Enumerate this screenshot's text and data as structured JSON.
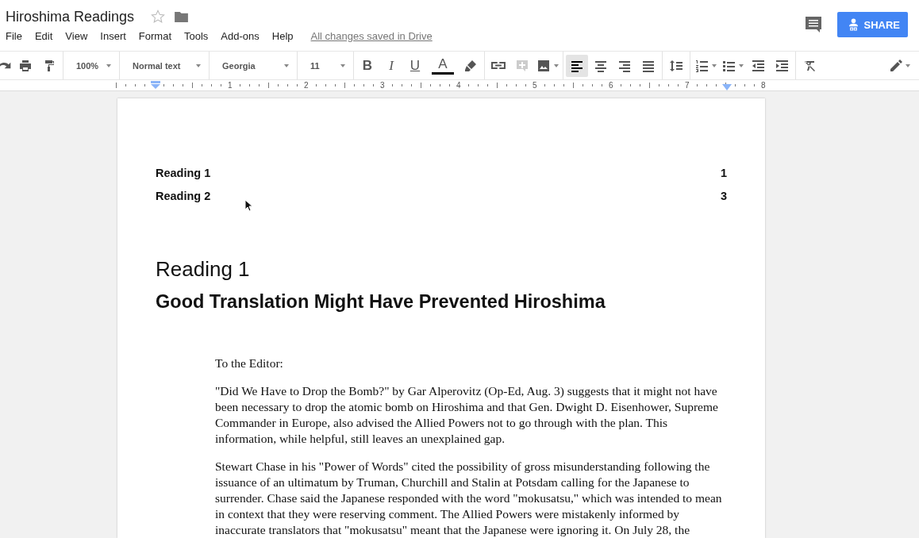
{
  "document": {
    "title": "Hiroshima Readings",
    "save_status": "All changes saved in Drive"
  },
  "menu": [
    "File",
    "Edit",
    "View",
    "Insert",
    "Format",
    "Tools",
    "Add-ons",
    "Help"
  ],
  "share_button": "SHARE",
  "toolbar": [
    {
      "kind": "redo",
      "selected": false
    },
    {
      "kind": "print",
      "selected": false
    },
    {
      "kind": "paint-format",
      "selected": false
    },
    {
      "kind": "separator"
    },
    {
      "kind": "dropdown",
      "label": "100%"
    },
    {
      "kind": "separator"
    },
    {
      "kind": "dropdown",
      "label": "Normal text"
    },
    {
      "kind": "separator"
    },
    {
      "kind": "dropdown",
      "label": "Georgia"
    },
    {
      "kind": "separator"
    },
    {
      "kind": "dropdown",
      "label": "11"
    },
    {
      "kind": "separator"
    },
    {
      "kind": "bold",
      "label": "B",
      "selected": false
    },
    {
      "kind": "italic",
      "label": "I",
      "selected": false
    },
    {
      "kind": "underline",
      "label": "U",
      "selected": false
    },
    {
      "kind": "text-color",
      "label": "A",
      "selected": false
    },
    {
      "kind": "highlight",
      "selected": false
    },
    {
      "kind": "separator"
    },
    {
      "kind": "link",
      "selected": false
    },
    {
      "kind": "comment",
      "selected": false
    },
    {
      "kind": "image",
      "selected": false
    },
    {
      "kind": "separator"
    },
    {
      "kind": "align-left",
      "selected": true
    },
    {
      "kind": "align-center",
      "selected": false
    },
    {
      "kind": "align-right",
      "selected": false
    },
    {
      "kind": "align-justify",
      "selected": false
    },
    {
      "kind": "separator"
    },
    {
      "kind": "line-spacing",
      "selected": false
    },
    {
      "kind": "separator"
    },
    {
      "kind": "numbered-list",
      "selected": false
    },
    {
      "kind": "bulleted-list",
      "selected": false
    },
    {
      "kind": "indent-less",
      "selected": false
    },
    {
      "kind": "indent-more",
      "selected": false
    },
    {
      "kind": "separator"
    },
    {
      "kind": "clear-format",
      "selected": false
    },
    {
      "kind": "spacer"
    },
    {
      "kind": "pencil",
      "selected": false
    }
  ],
  "ruler": [
    "1",
    "2",
    "3",
    "4",
    "5",
    "6",
    "7",
    "8"
  ],
  "page": {
    "toc": [
      {
        "label": "Reading 1",
        "page": "1"
      },
      {
        "label": "Reading 2",
        "page": "3"
      }
    ],
    "heading": "Reading 1",
    "title": "Good Translation Might Have Prevented Hiroshima",
    "paragraphs": [
      "To the Editor:",
      "\"Did We Have to Drop the Bomb?\" by Gar Alperovitz (Op-Ed, Aug. 3) suggests that it might not have been necessary to drop the atomic bomb on Hiroshima and that Gen. Dwight D. Eisenhower, Supreme Commander in Europe, also advised the Allied Powers not to go through with the plan. This information, while helpful, still leaves an unexplained gap.",
      "Stewart Chase in his \"Power of Words\" cited the possibility of gross misunderstanding following the issuance of an ultimatum by Truman, Churchill and Stalin at Potsdam calling for the Japanese to surrender. Chase said the Japanese responded with the word \"mokusatsu,\" which was intended to mean in context that they were reserving comment. The Allied Powers were mistakenly informed by inaccurate translators that \"mokusatsu\" meant that the Japanese were ignoring it. On July 28, the"
    ]
  }
}
